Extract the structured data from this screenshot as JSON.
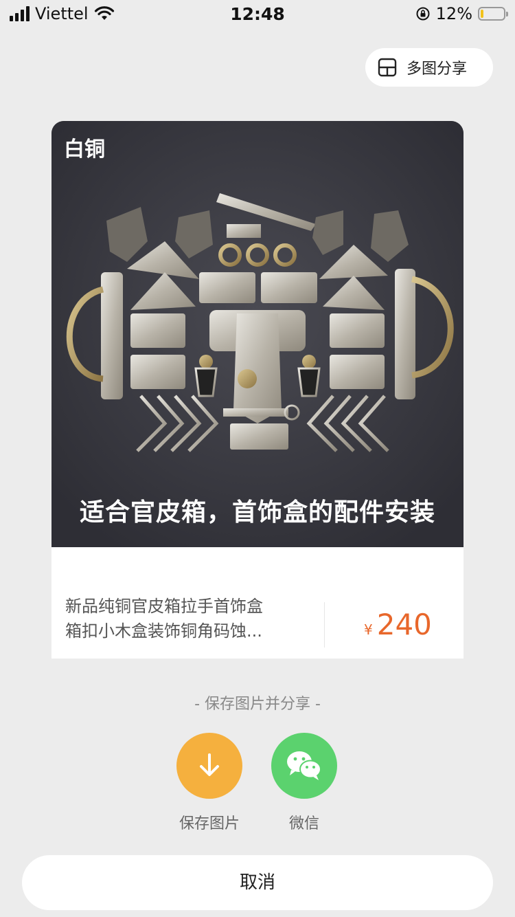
{
  "status_bar": {
    "carrier": "Viettel",
    "time": "12:48",
    "battery_percent": "12%",
    "battery_level": 0.12,
    "icons": [
      "signal-icon",
      "wifi-icon",
      "orientation-lock-icon",
      "battery-icon"
    ]
  },
  "multi_share": {
    "label": "多图分享",
    "icon": "grid-layout-icon"
  },
  "product": {
    "image_tag": "白铜",
    "image_caption": "适合官皮箱，首饰盒的配件安装",
    "title_line1": "新品纯铜官皮箱拉手首饰盒",
    "title_line2": "箱扣小木盒装饰铜角码蚀...",
    "price_symbol": "¥",
    "price": "240"
  },
  "share": {
    "hint": "- 保存图片并分享 -",
    "save_label": "保存图片",
    "wechat_label": "微信",
    "save_color": "#f5b03e",
    "wechat_color": "#5bd26e"
  },
  "cancel_label": "取消",
  "colors": {
    "background": "#ececec",
    "price": "#e8672b"
  }
}
